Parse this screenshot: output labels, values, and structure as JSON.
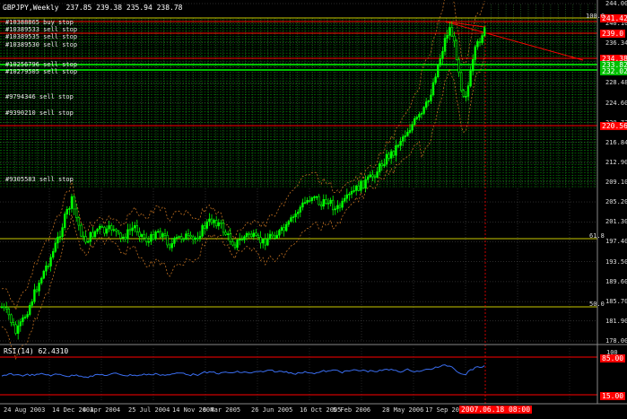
{
  "header": {
    "symbol_label": "GBPJPY,Weekly",
    "ohlc": "237.85 239.38 235.94 238.78"
  },
  "price_axis": {
    "labels": [
      "244.00",
      "240.10",
      "236.34",
      "232.40",
      "228.48",
      "224.60",
      "220.72",
      "216.84",
      "212.90",
      "209.10",
      "205.20",
      "201.30",
      "197.40",
      "193.50",
      "189.60",
      "185.70",
      "181.90",
      "178.00"
    ],
    "fib_labels": [
      "100.0",
      "61.8",
      "50.0"
    ],
    "highlight_labels": [
      {
        "text": "241.42",
        "color": "#ff0000"
      },
      {
        "text": "239.0",
        "color": "#ff0000"
      },
      {
        "text": "234.38",
        "color": "#ff0000"
      },
      {
        "text": "233.82",
        "color": "#00c000"
      },
      {
        "text": "232.02",
        "color": "#00c000"
      },
      {
        "text": "220.56",
        "color": "#ff0000"
      }
    ]
  },
  "orders": {
    "top": [
      "#10388865 buy stop",
      "#10389533 sell stop",
      "#10389535 sell stop",
      "#10389530 sell stop",
      "#10256796 sell stop",
      "#10279505 sell stop"
    ],
    "mid": [
      "#9794346 sell stop",
      "#9390210 sell stop"
    ],
    "bottom": "#9305583 sell stop"
  },
  "rsi": {
    "label": "RSI(14) 62.4310",
    "axis": [
      "100",
      "0"
    ],
    "levels": [
      "85.00",
      "15.00"
    ]
  },
  "time_axis": {
    "labels": [
      "24 Aug 2003",
      "14 Dec 2003",
      "4 Apr 2004",
      "25 Jul 2004",
      "14 Nov 2004",
      "6 Mar 2005",
      "26 Jun 2005",
      "16 Oct 2005",
      "5 Feb 2006",
      "28 May 2006",
      "17 Sep 2006",
      "7 Jan 2007"
    ],
    "crosshair": "2007.06.18 08:00"
  },
  "colors": {
    "background": "#000000",
    "bull": "#00ff00",
    "grid": "#2e7d2e",
    "order_line": "#00c000",
    "rsi": "#3a6df0",
    "envelope": "#c07020",
    "fib": "#c8c800",
    "stop": "#ff0000"
  }
}
